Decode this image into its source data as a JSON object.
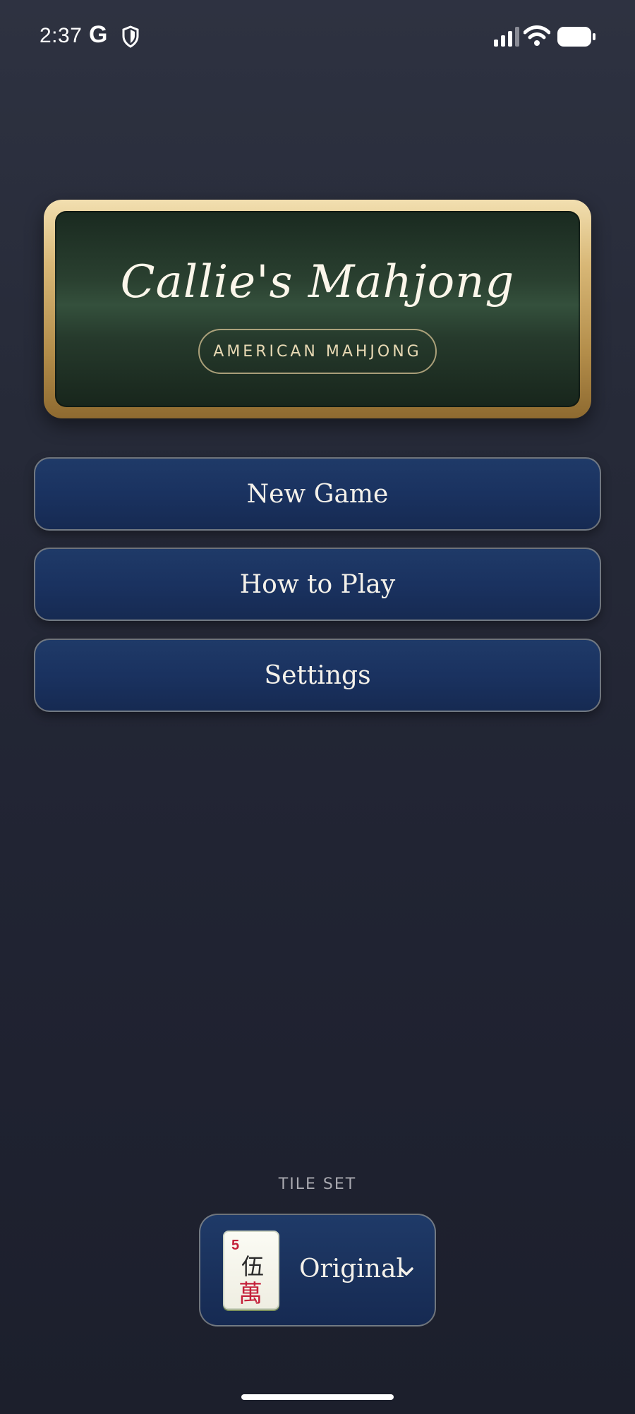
{
  "status_bar": {
    "time": "2:37",
    "g_letter": "G",
    "icons": [
      "google-icon",
      "shield-icon",
      "signal-icon",
      "wifi-icon",
      "battery-icon"
    ]
  },
  "title_card": {
    "title": "Callie's Mahjong",
    "subtitle": "AMERICAN MAHJONG"
  },
  "menu": {
    "new_game": "New Game",
    "how_to_play": "How to Play",
    "settings": "Settings"
  },
  "tile_set": {
    "label": "TILE SET",
    "selected": "Original",
    "preview_tile": {
      "number": "5",
      "top_char": "伍",
      "bottom_char": "萬"
    }
  },
  "colors": {
    "background": "#262a38",
    "button": "#1a3260",
    "felt": "#2a4030",
    "gold": "#d8b776",
    "tile_red": "#c4203a"
  }
}
